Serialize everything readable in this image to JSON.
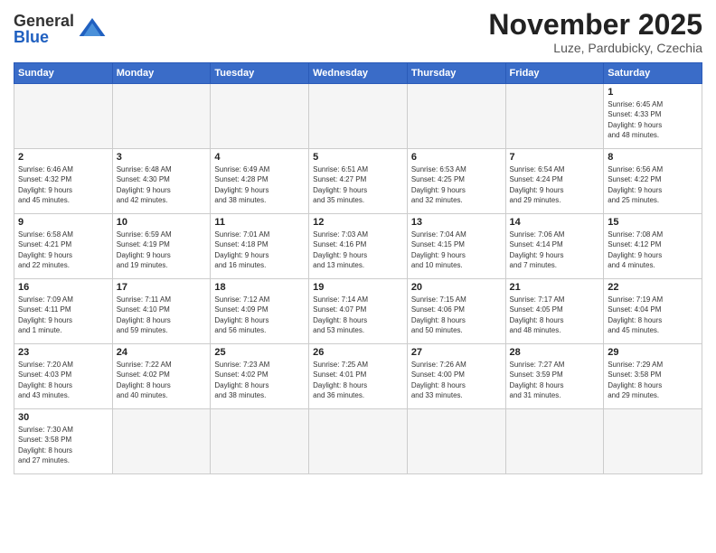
{
  "header": {
    "logo_general": "General",
    "logo_blue": "Blue",
    "month": "November 2025",
    "location": "Luze, Pardubicky, Czechia"
  },
  "weekdays": [
    "Sunday",
    "Monday",
    "Tuesday",
    "Wednesday",
    "Thursday",
    "Friday",
    "Saturday"
  ],
  "weeks": [
    [
      {
        "day": "",
        "info": ""
      },
      {
        "day": "",
        "info": ""
      },
      {
        "day": "",
        "info": ""
      },
      {
        "day": "",
        "info": ""
      },
      {
        "day": "",
        "info": ""
      },
      {
        "day": "",
        "info": ""
      },
      {
        "day": "1",
        "info": "Sunrise: 6:45 AM\nSunset: 4:33 PM\nDaylight: 9 hours\nand 48 minutes."
      }
    ],
    [
      {
        "day": "2",
        "info": "Sunrise: 6:46 AM\nSunset: 4:32 PM\nDaylight: 9 hours\nand 45 minutes."
      },
      {
        "day": "3",
        "info": "Sunrise: 6:48 AM\nSunset: 4:30 PM\nDaylight: 9 hours\nand 42 minutes."
      },
      {
        "day": "4",
        "info": "Sunrise: 6:49 AM\nSunset: 4:28 PM\nDaylight: 9 hours\nand 38 minutes."
      },
      {
        "day": "5",
        "info": "Sunrise: 6:51 AM\nSunset: 4:27 PM\nDaylight: 9 hours\nand 35 minutes."
      },
      {
        "day": "6",
        "info": "Sunrise: 6:53 AM\nSunset: 4:25 PM\nDaylight: 9 hours\nand 32 minutes."
      },
      {
        "day": "7",
        "info": "Sunrise: 6:54 AM\nSunset: 4:24 PM\nDaylight: 9 hours\nand 29 minutes."
      },
      {
        "day": "8",
        "info": "Sunrise: 6:56 AM\nSunset: 4:22 PM\nDaylight: 9 hours\nand 25 minutes."
      }
    ],
    [
      {
        "day": "9",
        "info": "Sunrise: 6:58 AM\nSunset: 4:21 PM\nDaylight: 9 hours\nand 22 minutes."
      },
      {
        "day": "10",
        "info": "Sunrise: 6:59 AM\nSunset: 4:19 PM\nDaylight: 9 hours\nand 19 minutes."
      },
      {
        "day": "11",
        "info": "Sunrise: 7:01 AM\nSunset: 4:18 PM\nDaylight: 9 hours\nand 16 minutes."
      },
      {
        "day": "12",
        "info": "Sunrise: 7:03 AM\nSunset: 4:16 PM\nDaylight: 9 hours\nand 13 minutes."
      },
      {
        "day": "13",
        "info": "Sunrise: 7:04 AM\nSunset: 4:15 PM\nDaylight: 9 hours\nand 10 minutes."
      },
      {
        "day": "14",
        "info": "Sunrise: 7:06 AM\nSunset: 4:14 PM\nDaylight: 9 hours\nand 7 minutes."
      },
      {
        "day": "15",
        "info": "Sunrise: 7:08 AM\nSunset: 4:12 PM\nDaylight: 9 hours\nand 4 minutes."
      }
    ],
    [
      {
        "day": "16",
        "info": "Sunrise: 7:09 AM\nSunset: 4:11 PM\nDaylight: 9 hours\nand 1 minute."
      },
      {
        "day": "17",
        "info": "Sunrise: 7:11 AM\nSunset: 4:10 PM\nDaylight: 8 hours\nand 59 minutes."
      },
      {
        "day": "18",
        "info": "Sunrise: 7:12 AM\nSunset: 4:09 PM\nDaylight: 8 hours\nand 56 minutes."
      },
      {
        "day": "19",
        "info": "Sunrise: 7:14 AM\nSunset: 4:07 PM\nDaylight: 8 hours\nand 53 minutes."
      },
      {
        "day": "20",
        "info": "Sunrise: 7:15 AM\nSunset: 4:06 PM\nDaylight: 8 hours\nand 50 minutes."
      },
      {
        "day": "21",
        "info": "Sunrise: 7:17 AM\nSunset: 4:05 PM\nDaylight: 8 hours\nand 48 minutes."
      },
      {
        "day": "22",
        "info": "Sunrise: 7:19 AM\nSunset: 4:04 PM\nDaylight: 8 hours\nand 45 minutes."
      }
    ],
    [
      {
        "day": "23",
        "info": "Sunrise: 7:20 AM\nSunset: 4:03 PM\nDaylight: 8 hours\nand 43 minutes."
      },
      {
        "day": "24",
        "info": "Sunrise: 7:22 AM\nSunset: 4:02 PM\nDaylight: 8 hours\nand 40 minutes."
      },
      {
        "day": "25",
        "info": "Sunrise: 7:23 AM\nSunset: 4:02 PM\nDaylight: 8 hours\nand 38 minutes."
      },
      {
        "day": "26",
        "info": "Sunrise: 7:25 AM\nSunset: 4:01 PM\nDaylight: 8 hours\nand 36 minutes."
      },
      {
        "day": "27",
        "info": "Sunrise: 7:26 AM\nSunset: 4:00 PM\nDaylight: 8 hours\nand 33 minutes."
      },
      {
        "day": "28",
        "info": "Sunrise: 7:27 AM\nSunset: 3:59 PM\nDaylight: 8 hours\nand 31 minutes."
      },
      {
        "day": "29",
        "info": "Sunrise: 7:29 AM\nSunset: 3:58 PM\nDaylight: 8 hours\nand 29 minutes."
      }
    ],
    [
      {
        "day": "30",
        "info": "Sunrise: 7:30 AM\nSunset: 3:58 PM\nDaylight: 8 hours\nand 27 minutes."
      },
      {
        "day": "",
        "info": ""
      },
      {
        "day": "",
        "info": ""
      },
      {
        "day": "",
        "info": ""
      },
      {
        "day": "",
        "info": ""
      },
      {
        "day": "",
        "info": ""
      },
      {
        "day": "",
        "info": ""
      }
    ]
  ]
}
